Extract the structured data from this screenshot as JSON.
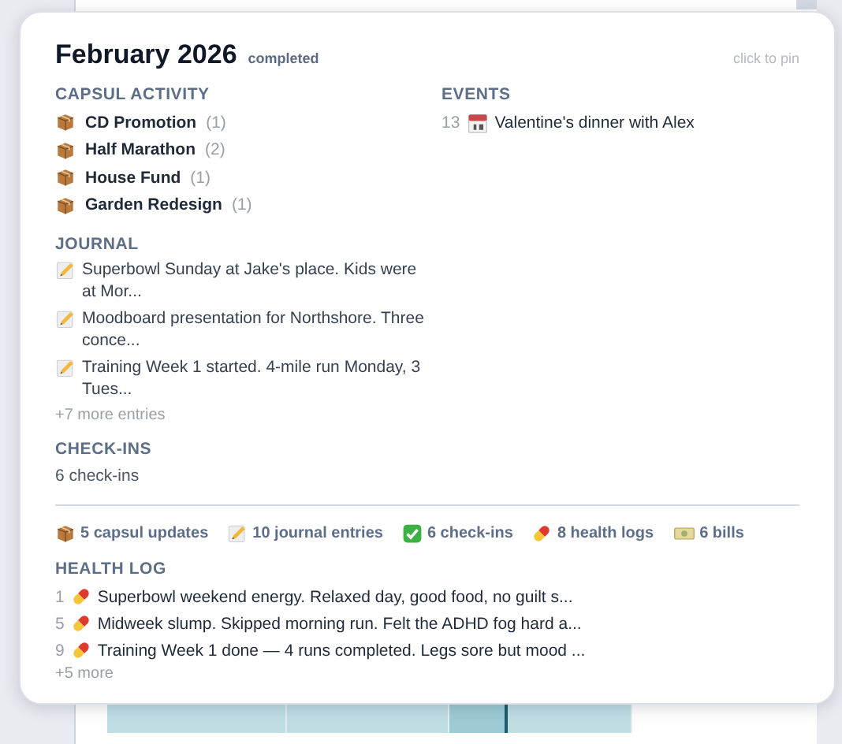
{
  "header": {
    "title": "February 2026",
    "status": "completed",
    "hint": "click to pin"
  },
  "capsul_activity": {
    "heading": "CAPSUL ACTIVITY",
    "items": [
      {
        "name": "CD Promotion",
        "count": "(1)"
      },
      {
        "name": "Half Marathon",
        "count": "(2)"
      },
      {
        "name": "House Fund",
        "count": "(1)"
      },
      {
        "name": "Garden Redesign",
        "count": "(1)"
      }
    ]
  },
  "events": {
    "heading": "EVENTS",
    "items": [
      {
        "day": "13",
        "title": "Valentine's dinner with Alex"
      }
    ]
  },
  "journal": {
    "heading": "JOURNAL",
    "entries": [
      "Superbowl Sunday at Jake's place. Kids were at Mor...",
      "Moodboard presentation for Northshore. Three conce...",
      "Training Week 1 started. 4-mile run Monday, 3 Tues..."
    ],
    "more": "+7 more entries"
  },
  "check_ins": {
    "heading": "CHECK-INS",
    "summary": "6 check-ins"
  },
  "summary": [
    {
      "kind": "capsul",
      "label": "5 capsul updates"
    },
    {
      "kind": "journal",
      "label": "10 journal entries"
    },
    {
      "kind": "check_in",
      "label": "6 check-ins"
    },
    {
      "kind": "health",
      "label": "8 health logs"
    },
    {
      "kind": "bill",
      "label": "6 bills"
    }
  ],
  "health_log": {
    "heading": "HEALTH LOG",
    "entries": [
      {
        "day": "1",
        "text": "Superbowl weekend energy. Relaxed day, good food, no guilt s..."
      },
      {
        "day": "5",
        "text": "Midweek slump. Skipped morning run. Felt the ADHD fog hard a..."
      },
      {
        "day": "9",
        "text": "Training Week 1 done — 4 runs completed. Legs sore but mood ..."
      }
    ],
    "more": "+5 more"
  }
}
